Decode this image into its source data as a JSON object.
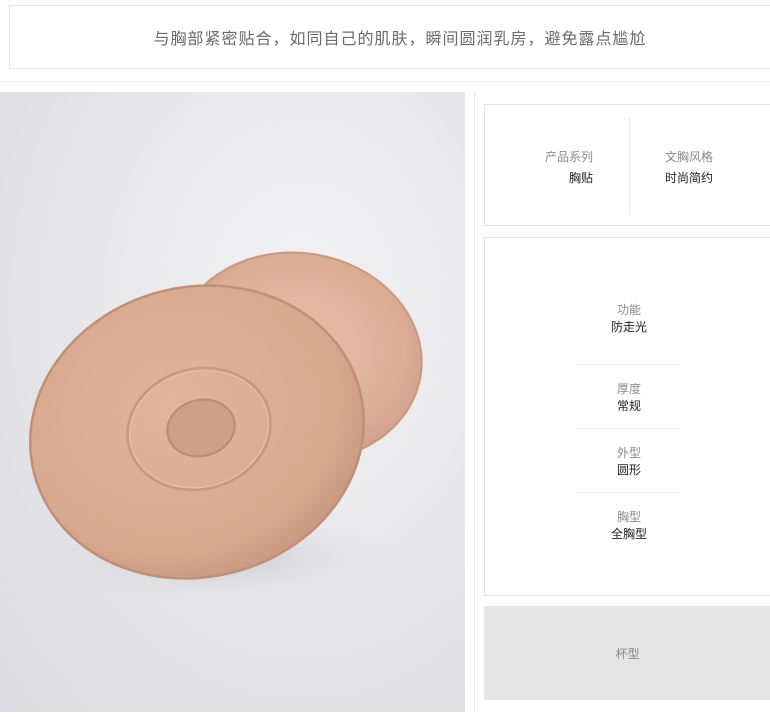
{
  "headline": "与胸部紧密贴合，如同自己的肌肤，瞬间圆润乳房，避免露点尴尬",
  "specs_top": [
    {
      "label": "产品系列",
      "value": "胸贴"
    },
    {
      "label": "文胸风格",
      "value": "时尚简约"
    }
  ],
  "specs_mid": [
    {
      "label": "功能",
      "value": "防走光"
    },
    {
      "label": "厚度",
      "value": "常规"
    },
    {
      "label": "外型",
      "value": "圆形"
    },
    {
      "label": "胸型",
      "value": "全胸型"
    }
  ],
  "spec_bottom_label": "杯型",
  "colors": {
    "pad": "#dcae98",
    "pad_shadow": "#c99a84",
    "background": "#e6e6ea",
    "cup_bar": "#e5e5e5"
  }
}
